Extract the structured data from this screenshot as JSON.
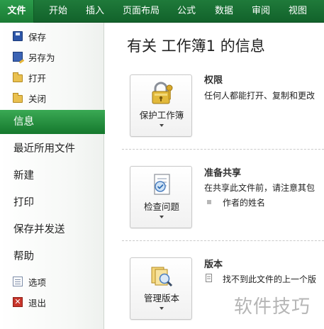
{
  "ribbon": {
    "file_tab": "文件",
    "tabs": [
      "开始",
      "插入",
      "页面布局",
      "公式",
      "数据",
      "审阅",
      "视图"
    ]
  },
  "sidebar": {
    "save": "保存",
    "save_as": "另存为",
    "open": "打开",
    "close": "关闭",
    "info": "信息",
    "recent": "最近所用文件",
    "new": "新建",
    "print": "打印",
    "save_send": "保存并发送",
    "help": "帮助",
    "options": "选项",
    "exit": "退出",
    "exit_icon_glyph": "✕"
  },
  "main": {
    "title": "有关 工作簿1 的信息",
    "permissions": {
      "button_label": "保护工作簿",
      "heading": "权限",
      "description": "任何人都能打开、复制和更改"
    },
    "prepare": {
      "button_label": "检查问题",
      "heading": "准备共享",
      "description": "在共享此文件前，请注意其包",
      "bullet": "作者的姓名"
    },
    "versions": {
      "button_label": "管理版本",
      "heading": "版本",
      "description": "找不到此文件的上一个版"
    }
  },
  "watermark": "软件技巧",
  "colors": {
    "ribbon_green": "#1f7a3a",
    "active_item_green": "#2a9340"
  }
}
